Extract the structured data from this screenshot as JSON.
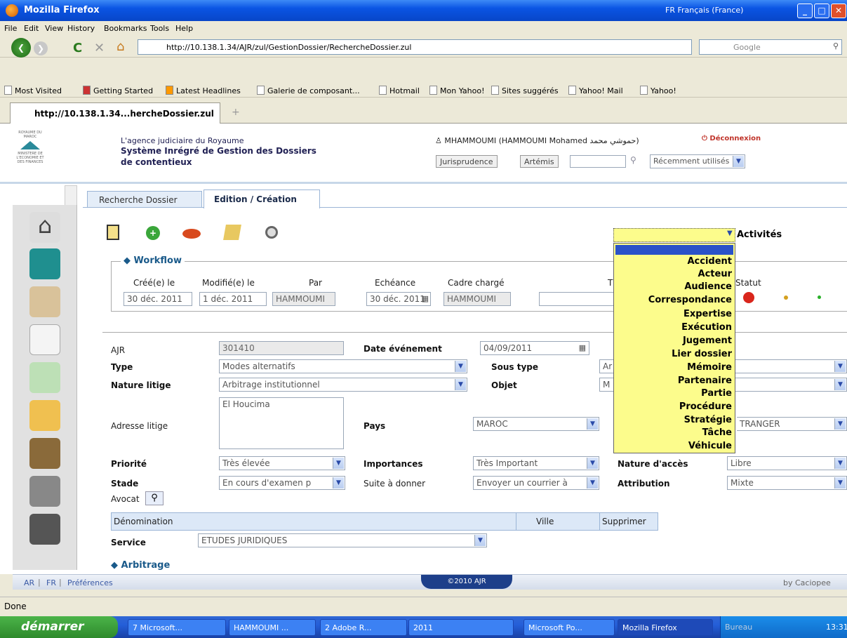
{
  "window": {
    "title": "Mozilla Firefox",
    "language": "FR Français (France)"
  },
  "menu": [
    "File",
    "Edit",
    "View",
    "History",
    "Bookmarks",
    "Tools",
    "Help"
  ],
  "nav": {
    "url": "http://10.138.1.34/AJR/zul/GestionDossier/RechercheDossier.zul",
    "search_placeholder": "Google"
  },
  "bookmarks": [
    "Most Visited",
    "Getting Started",
    "Latest Headlines",
    "Galerie de composant...",
    "Hotmail",
    "Mon Yahoo!",
    "Sites suggérés",
    "Yahoo! Mail",
    "Yahoo!"
  ],
  "browser_tab": "http://10.138.1.34...hercheDossier.zul",
  "header": {
    "org": "ROYAUME DU MAROC",
    "ministry": "MINISTERE DE L'ECONOMIE ET DES FINANCES",
    "agency": "L'agence judiciaire du Royaume",
    "system_line1": "Système Inrégré de Gestion des Dossiers",
    "system_line2": "de contentieux",
    "user": "MHAMMOUMI (HAMMOUMI Mohamed حموشي محمد)",
    "logout": "Déconnexion",
    "btn_juris": "Jurisprudence",
    "btn_artemis": "Artémis",
    "recent": "Récemment utilisés"
  },
  "tabs": [
    "Recherche Dossier",
    "Edition / Création"
  ],
  "activities_label": "Activités",
  "workflow": {
    "title": "Workflow",
    "cols": [
      "Créé(e) le",
      "Modifié(e) le",
      "Par",
      "Echéance",
      "Cadre chargé",
      "T",
      "Statut"
    ],
    "created": "30 déc. 2011",
    "modified": "1 déc. 2011",
    "by": "HAMMOUMI",
    "due": "30 déc. 2011",
    "officer": "HAMMOUMI"
  },
  "dropdown": [
    "Accident",
    "Acteur",
    "Audience",
    "Correspondance",
    "Expertise",
    "Exécution",
    "Jugement",
    "Lier dossier",
    "Mémoire",
    "Partenaire",
    "Partie",
    "Procédure",
    "Stratégie",
    "Tâche",
    "Véhicule"
  ],
  "form": {
    "ajr_label": "AJR",
    "ajr": "301410",
    "date_label": "Date événement",
    "date": "04/09/2011",
    "type_label": "Type",
    "type": "Modes alternatifs",
    "soustype_label": "Sous type",
    "soustype": "Ar",
    "nature_label": "Nature litige",
    "nature": "Arbitrage institutionnel",
    "objet_label": "Objet",
    "objet": "M",
    "adresse_label": "Adresse litige",
    "adresse": "El Houcima",
    "pays_label": "Pays",
    "pays": "MAROC",
    "pays2": "TRANGER",
    "priorite_label": "Priorité",
    "priorite": "Très élevée",
    "importances_label": "Importances",
    "importances": "Très Important",
    "acces_label": "Nature d'accès",
    "acces": "Libre",
    "stade_label": "Stade",
    "stade": "En cours d'examen p",
    "suite_label": "Suite à donner",
    "suite": "Envoyer un courrier à",
    "attribution_label": "Attribution",
    "attribution": "Mixte",
    "avocat_label": "Avocat",
    "table_cols": [
      "Dénomination",
      "Ville",
      "Supprimer"
    ],
    "service_label": "Service",
    "service": "ETUDES JURIDIQUES",
    "arbitrage": "Arbitrage"
  },
  "footer": {
    "ar": "AR",
    "fr": "FR",
    "prefs": "Préférences",
    "copy": "©2010 AJR",
    "by": "by Caciopee"
  },
  "status": "Done",
  "taskbar": {
    "start": "démarrer",
    "items": [
      "7 Microsoft...",
      "HAMMOUMI ...",
      "2 Adobe R...",
      "2011",
      "Microsoft Po...",
      "Mozilla Firefox"
    ],
    "bureau": "Bureau",
    "time": "13:31"
  }
}
